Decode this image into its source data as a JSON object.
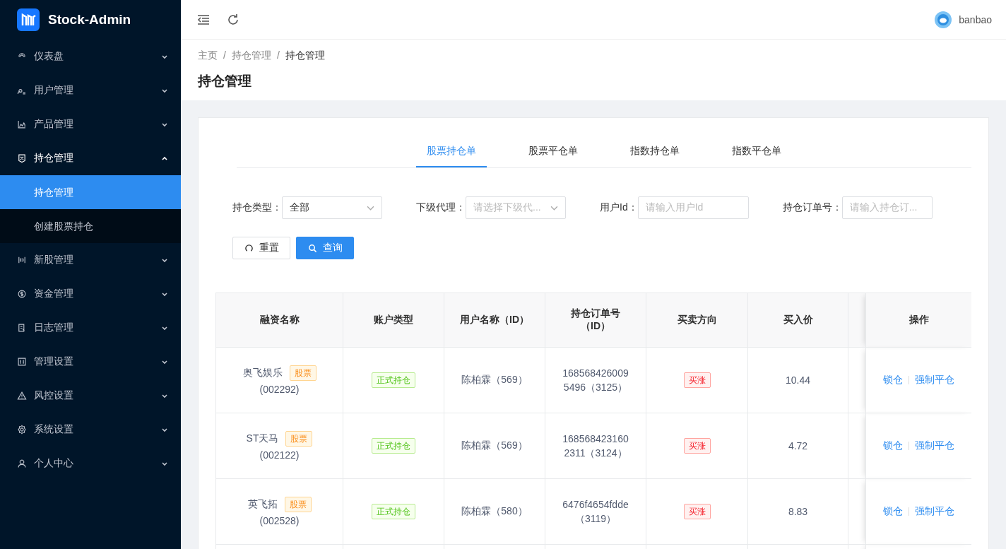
{
  "app": {
    "title": "Stock-Admin"
  },
  "sidebar": {
    "items": [
      {
        "label": "仪表盘",
        "expanded": false
      },
      {
        "label": "用户管理",
        "expanded": false
      },
      {
        "label": "产品管理",
        "expanded": false
      },
      {
        "label": "持仓管理",
        "expanded": true,
        "children": [
          {
            "label": "持仓管理",
            "selected": true
          },
          {
            "label": "创建股票持仓",
            "selected": false
          }
        ]
      },
      {
        "label": "新股管理",
        "expanded": false
      },
      {
        "label": "资金管理",
        "expanded": false
      },
      {
        "label": "日志管理",
        "expanded": false
      },
      {
        "label": "管理设置",
        "expanded": false
      },
      {
        "label": "风控设置",
        "expanded": false
      },
      {
        "label": "系统设置",
        "expanded": false
      },
      {
        "label": "个人中心",
        "expanded": false
      }
    ]
  },
  "header": {
    "user": "banbao"
  },
  "breadcrumb": {
    "items": [
      "主页",
      "持仓管理",
      "持仓管理"
    ],
    "separator": "/"
  },
  "page_title": "持仓管理",
  "tabs": [
    {
      "label": "股票持仓单",
      "selected": true
    },
    {
      "label": "股票平仓单",
      "selected": false
    },
    {
      "label": "指数持仓单",
      "selected": false
    },
    {
      "label": "指数平仓单",
      "selected": false
    }
  ],
  "filters": [
    {
      "kind": "select",
      "label": "持仓类型：",
      "value": "全部"
    },
    {
      "kind": "select",
      "label": "下级代理：",
      "placeholder": "请选择下级代..."
    },
    {
      "kind": "input",
      "label": "用户Id：",
      "placeholder": "请输入用户Id"
    },
    {
      "kind": "input",
      "label": "持仓订单号：",
      "placeholder": "请输入持仓订..."
    }
  ],
  "buttons": [
    {
      "kind": "reset",
      "label": "重置"
    },
    {
      "kind": "search",
      "label": "查询"
    }
  ],
  "table": {
    "columns": [
      "融资名称",
      "账户类型",
      "用户名称（ID）",
      "持仓订单号（ID）",
      "买卖方向",
      "买入价",
      "操作"
    ],
    "rows": [
      {
        "name": "奥飞娱乐",
        "tag": "股票",
        "code": "(002292)",
        "account_type": "正式持仓",
        "user": "陈柏霖（569）",
        "order": "1685684260095496（3125）",
        "direction": "买涨",
        "buy_price": "10.44",
        "actions": [
          "锁仓",
          "强制平仓"
        ]
      },
      {
        "name": "ST天马",
        "tag": "股票",
        "code": "(002122)",
        "account_type": "正式持仓",
        "user": "陈柏霖（569）",
        "order": "1685684231602311（3124）",
        "direction": "买涨",
        "buy_price": "4.72",
        "actions": [
          "锁仓",
          "强制平仓"
        ]
      },
      {
        "name": "英飞拓",
        "tag": "股票",
        "code": "(002528)",
        "account_type": "正式持仓",
        "user": "陈柏霖（580）",
        "order": "6476f4654fdde（3119）",
        "direction": "买涨",
        "buy_price": "8.83",
        "actions": [
          "锁仓",
          "强制平仓"
        ]
      }
    ]
  }
}
